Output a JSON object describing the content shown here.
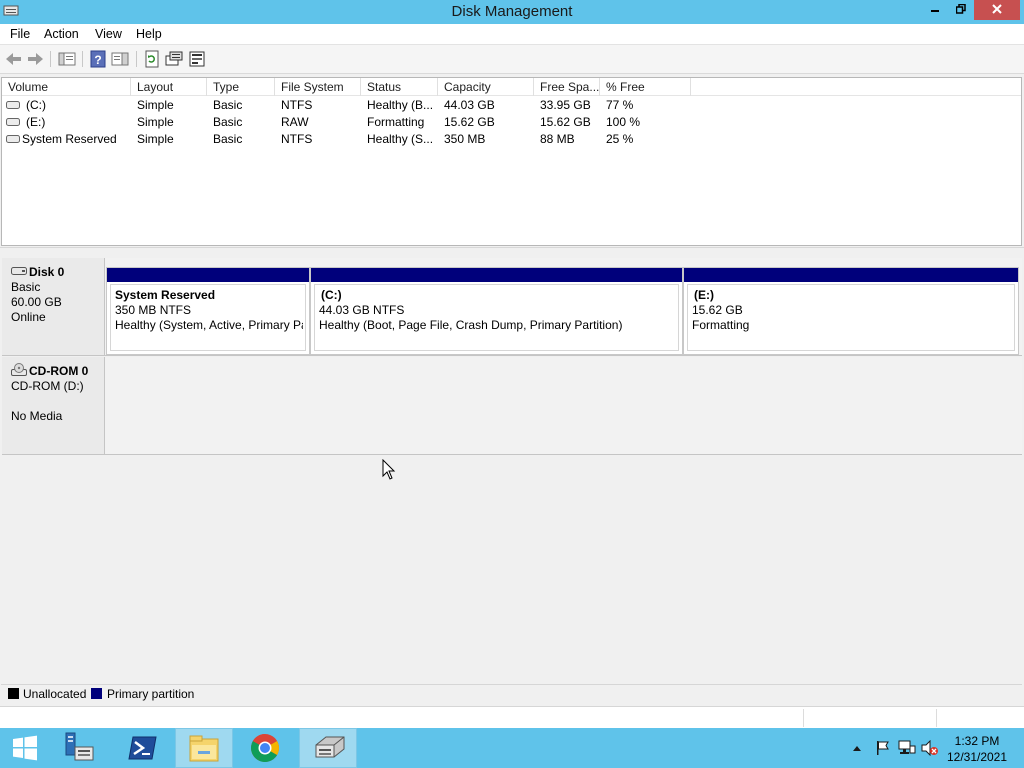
{
  "window": {
    "title": "Disk Management",
    "icon": "disk-management-icon",
    "controls": [
      "minimize-icon",
      "restore-icon",
      "close-icon"
    ]
  },
  "menu": [
    "File",
    "Action",
    "View",
    "Help"
  ],
  "toolbar": {
    "icons": [
      "back-arrow-icon",
      "forward-arrow-icon",
      "show-hide-console-tree-icon",
      "help-icon",
      "properties-pane-icon",
      "refresh-icon",
      "disk-properties-icon",
      "rescan-disks-icon"
    ]
  },
  "volume_list": {
    "columns": [
      "Volume",
      "Layout",
      "Type",
      "File System",
      "Status",
      "Capacity",
      "Free Spa...",
      "% Free"
    ],
    "rows": [
      {
        "volume": "(C:)",
        "layout": "Simple",
        "type": "Basic",
        "fs": "NTFS",
        "status": "Healthy (B...",
        "capacity": "44.03 GB",
        "free": "33.95 GB",
        "pct": "77 %"
      },
      {
        "volume": "(E:)",
        "layout": "Simple",
        "type": "Basic",
        "fs": "RAW",
        "status": "Formatting",
        "capacity": "15.62 GB",
        "free": "15.62 GB",
        "pct": "100 %"
      },
      {
        "volume": "System Reserved",
        "layout": "Simple",
        "type": "Basic",
        "fs": "NTFS",
        "status": "Healthy (S...",
        "capacity": "350 MB",
        "free": "88 MB",
        "pct": "25 %"
      }
    ]
  },
  "disks": [
    {
      "name": "Disk 0",
      "kind": "Basic",
      "size": "60.00 GB",
      "state": "Online",
      "partitions": [
        {
          "title": "System Reserved",
          "line1": "350 MB NTFS",
          "line2": "Healthy (System, Active, Primary Pa"
        },
        {
          "title": "(C:)",
          "line1": "44.03 GB NTFS",
          "line2": "Healthy (Boot, Page File, Crash Dump, Primary Partition)"
        },
        {
          "title": "(E:)",
          "line1": "15.62 GB",
          "line2": "Formatting"
        }
      ]
    },
    {
      "name": "CD-ROM 0",
      "kind": "CD-ROM (D:)",
      "state": "No Media"
    }
  ],
  "legend": {
    "unallocated": {
      "label": "Unallocated",
      "color": "#000000"
    },
    "primary": {
      "label": "Primary partition",
      "color": "#00007b"
    }
  },
  "taskbar": {
    "apps": [
      "start-icon",
      "server-manager-icon",
      "powershell-icon",
      "file-explorer-icon",
      "chrome-icon",
      "disk-management-taskbar-icon"
    ],
    "tray": [
      "show-hidden-icons-icon",
      "action-center-flag-icon",
      "network-icon",
      "volume-muted-icon"
    ],
    "time": "1:32 PM",
    "date": "12/31/2021"
  },
  "colors": {
    "titlebar": "#5fc3ea",
    "partition_bar": "#00007b",
    "close_button": "#c75050"
  }
}
